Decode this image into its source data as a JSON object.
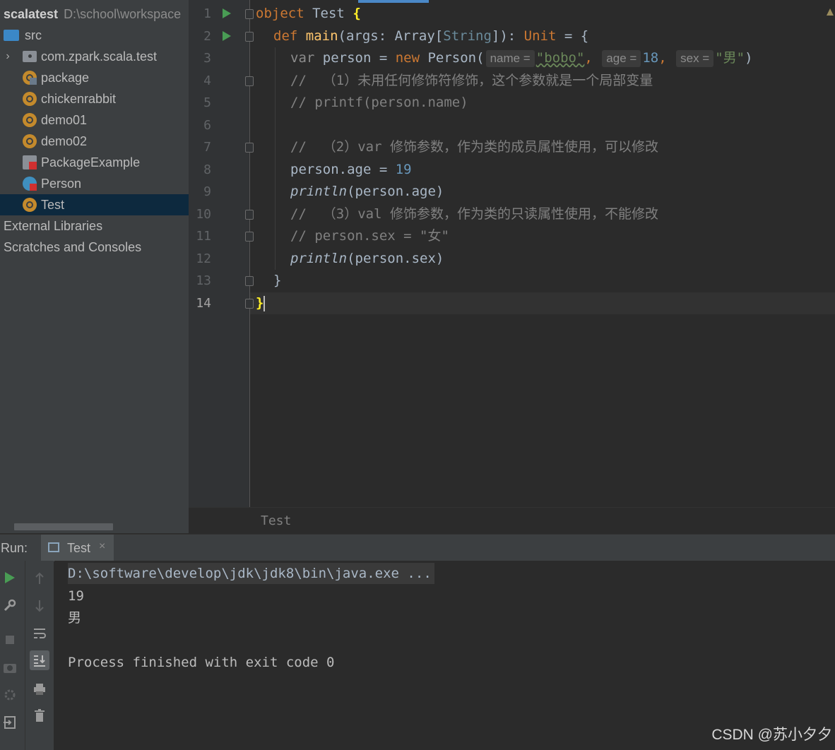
{
  "project": {
    "root": {
      "name": "scalatest",
      "path": "D:\\school\\workspace"
    },
    "items": [
      {
        "label": "src",
        "icon": "folder-icon"
      },
      {
        "label": "com.zpark.scala.test",
        "icon": "package-icon"
      },
      {
        "label": "package",
        "icon": "package-object-icon"
      },
      {
        "label": "chickenrabbit",
        "icon": "scala-object-icon"
      },
      {
        "label": "demo01",
        "icon": "scala-object-icon"
      },
      {
        "label": "demo02",
        "icon": "scala-object-icon"
      },
      {
        "label": "PackageExample",
        "icon": "scala-file-icon"
      },
      {
        "label": "Person",
        "icon": "scala-class-icon"
      },
      {
        "label": "Test",
        "icon": "scala-object-icon",
        "selected": true
      },
      {
        "label": "External Libraries"
      },
      {
        "label": "Scratches and Consoles"
      }
    ]
  },
  "editor": {
    "line_numbers": [
      "1",
      "2",
      "3",
      "4",
      "5",
      "6",
      "7",
      "8",
      "9",
      "10",
      "11",
      "12",
      "13",
      "14"
    ],
    "current_line": 14,
    "code": {
      "l1": {
        "kw": "object",
        "name": "Test",
        "brace": "{"
      },
      "l2": {
        "kw": "def",
        "fn": "main",
        "params": "(args: Array[",
        "type": "String",
        "rest": "]): ",
        "unit": "Unit",
        "tail": " = {"
      },
      "l3": {
        "kw": "var",
        "mid": " person = ",
        "new": "new",
        "cls": " Person(",
        "hint_name": "name =",
        "v_name": "\"bobo\"",
        "comma1": ",",
        "hint_age": "age =",
        "v_age": "18",
        "comma2": ",",
        "hint_sex": "sex =",
        "v_sex": "\"男\"",
        "close": ")"
      },
      "l4": "//  （1）未用任何修饰符修饰，这个参数就是一个局部变量",
      "l5": "// printf(person.name)",
      "l7": "//  （2）var 修饰参数，作为类的成员属性使用，可以修改",
      "l8": {
        "text": "person.age = ",
        "num": "19"
      },
      "l9": {
        "fn": "println",
        "args": "(person.age)"
      },
      "l10": "//  （3）val 修饰参数，作为类的只读属性使用，不能修改",
      "l11": "// person.sex = \"女\"",
      "l12": {
        "fn": "println",
        "args": "(person.sex)"
      },
      "l13": "}",
      "l14": "}"
    },
    "breadcrumb": "Test"
  },
  "run": {
    "label": "Run:",
    "tab": "Test",
    "close": "×",
    "output": [
      "D:\\software\\develop\\jdk\\jdk8\\bin\\java.exe ...",
      "19",
      "男",
      "",
      "Process finished with exit code 0"
    ]
  },
  "watermark": "CSDN @苏小夕夕"
}
